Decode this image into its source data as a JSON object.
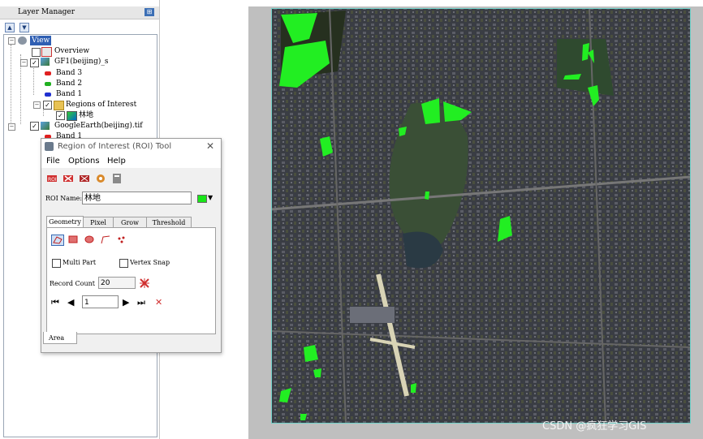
{
  "layer_manager": {
    "title": "Layer Manager",
    "tree": {
      "view": "View",
      "overview": "Overview",
      "gf1_layer": "GF1(beijing)_s",
      "bands": [
        "Band 3",
        "Band 2",
        "Band 1"
      ],
      "band_colors": [
        "#e02020",
        "#20b020",
        "#2030d0"
      ],
      "regions_folder": "Regions of Interest",
      "roi_item": "林地",
      "google_layer": "GoogleEarth(beijing).tif",
      "google_band": "Band 1"
    }
  },
  "roi_tool": {
    "title": "Region of Interest (ROI) Tool",
    "menu": [
      "File",
      "Options",
      "Help"
    ],
    "roi_name_label": "ROI Name:",
    "roi_name_value": "林地",
    "roi_color": "#19e619",
    "tabs": [
      "Geometry",
      "Pixel",
      "Grow",
      "Threshold"
    ],
    "active_tab": "Geometry",
    "multi_part_label": "Multi Part",
    "multi_part_checked": false,
    "vertex_snap_label": "Vertex Snap",
    "vertex_snap_checked": false,
    "record_count_label": "Record Count",
    "record_count_value": "20",
    "navigation_value": "1",
    "bottom_tab": "Area"
  },
  "image_view": {
    "roi_fill_color": "#22ee22",
    "border_color": "#6fd0c8"
  },
  "watermark": "CSDN @疯狂学习GIS"
}
